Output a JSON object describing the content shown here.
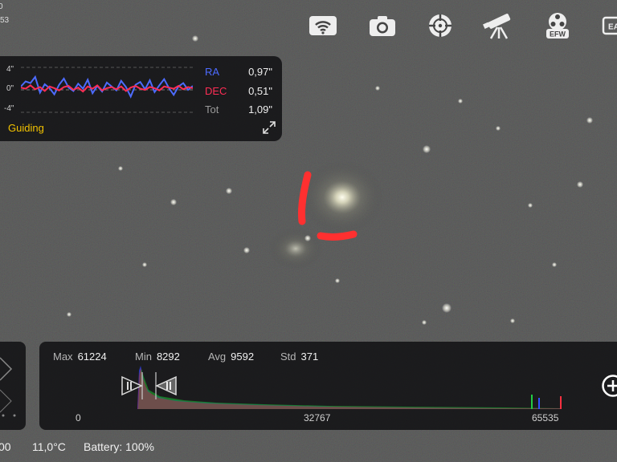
{
  "top_left": {
    "fragment_1": "0",
    "fragment_2": "53"
  },
  "toolbar": {
    "items": [
      {
        "icon": "wifi-icon"
      },
      {
        "icon": "camera-icon"
      },
      {
        "icon": "focus-crosshair-icon"
      },
      {
        "icon": "telescope-icon"
      },
      {
        "icon": "filter-wheel-icon",
        "label": "EFW"
      },
      {
        "icon": "eaf-icon",
        "label": "EA"
      }
    ]
  },
  "guiding": {
    "axis_top": "4\"",
    "axis_mid": "0\"",
    "axis_bottom": "-4\"",
    "ra_label": "RA",
    "ra_value": "0,97\"",
    "dec_label": "DEC",
    "dec_value": "0,51\"",
    "tot_label": "Tot",
    "tot_value": "1,09\"",
    "title": "Guiding",
    "ra_color": "#4d6bff",
    "dec_color": "#ff2d55",
    "ra_series": [
      0.6,
      1.5,
      1.2,
      2.3,
      -0.5,
      1.0,
      0.3,
      -0.8,
      0.9,
      2.0,
      0.4,
      -0.2,
      1.1,
      0.2,
      1.8,
      -0.6,
      0.7,
      -0.3,
      1.3,
      0.6,
      -0.1,
      1.6,
      0.5,
      -1.2,
      0.9,
      1.4,
      0.1,
      1.7,
      -0.4,
      0.8,
      1.9,
      0.3,
      -0.9,
      0.6,
      1.2,
      0.0,
      0.7
    ],
    "dec_series": [
      0.4,
      0.2,
      0.8,
      0.1,
      0.5,
      -0.2,
      0.6,
      0.3,
      -0.1,
      0.5,
      0.7,
      0.0,
      0.4,
      -0.3,
      0.6,
      0.2,
      0.8,
      -0.1,
      0.3,
      0.5,
      0.1,
      0.6,
      -0.2,
      0.4,
      0.7,
      0.2,
      0.0,
      0.5,
      0.3,
      -0.1,
      0.6,
      0.4,
      0.2,
      0.7,
      0.1,
      0.5,
      0.3
    ]
  },
  "histogram": {
    "stats": [
      {
        "label": "Max",
        "value": "61224"
      },
      {
        "label": "Min",
        "value": "8292"
      },
      {
        "label": "Avg",
        "value": "9592"
      },
      {
        "label": "Std",
        "value": "371"
      }
    ],
    "ticks": [
      "0",
      "32767",
      "65535"
    ]
  },
  "status_bar": {
    "exposure_fragment": "00",
    "temperature": "11,0°C",
    "battery": "Battery: 100%"
  },
  "colors": {
    "annotation": "#ff3030",
    "guiding_title": "#f2c200"
  }
}
